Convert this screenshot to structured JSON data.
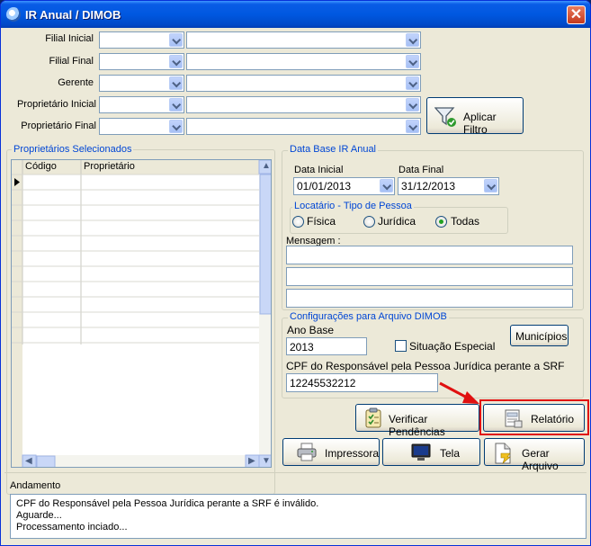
{
  "window": {
    "title": "IR Anual / DIMOB",
    "close_glyph": "✕"
  },
  "filters": {
    "filial_inicial": "Filial Inicial",
    "filial_final": "Filial Final",
    "gerente": "Gerente",
    "proprietario_inicial": "Proprietário Inicial",
    "proprietario_final": "Proprietário Final",
    "apply_label": "Aplicar Filtro"
  },
  "owners": {
    "title": "Proprietários Selecionados",
    "columns": [
      "Código",
      "Proprietário"
    ]
  },
  "database": {
    "title": "Data Base IR Anual",
    "start_label": "Data Inicial",
    "start_value": "01/01/2013",
    "end_label": "Data Final",
    "end_value": "31/12/2013"
  },
  "tenant": {
    "title": "Locatário - Tipo de Pessoa",
    "options": [
      "Física",
      "Jurídica",
      "Todas"
    ],
    "selected": "Todas"
  },
  "message": {
    "label": "Mensagem :"
  },
  "dimob": {
    "title": "Configurações para Arquivo DIMOB",
    "ano_label": "Ano Base",
    "ano_value": "2013",
    "situacao_label": "Situação Especial",
    "municipios_label": "Municípios",
    "cpf_label": "CPF do Responsável pela Pessoa  Jurídica perante a SRF",
    "cpf_value": "12245532212"
  },
  "actions": {
    "verificar": "Verificar Pendências",
    "relatorio": "Relatório",
    "impressora": "Impressora",
    "tela": "Tela",
    "gerar": "Gerar Arquivo"
  },
  "progress": {
    "title": "Andamento",
    "lines": [
      "CPF do Responsável pela Pessoa  Jurídica perante a SRF é inválido.",
      "Aguarde...",
      "Processamento inciado..."
    ]
  },
  "colors": {
    "highlight": "#e01010",
    "group_title": "#0046d5",
    "title_bar": "#0058e0"
  },
  "icons": {
    "apply": "funnel-icon",
    "verificar": "checklist-icon",
    "relatorio": "report-icon",
    "impressora": "printer-icon",
    "tela": "monitor-icon",
    "gerar": "file-icon"
  }
}
